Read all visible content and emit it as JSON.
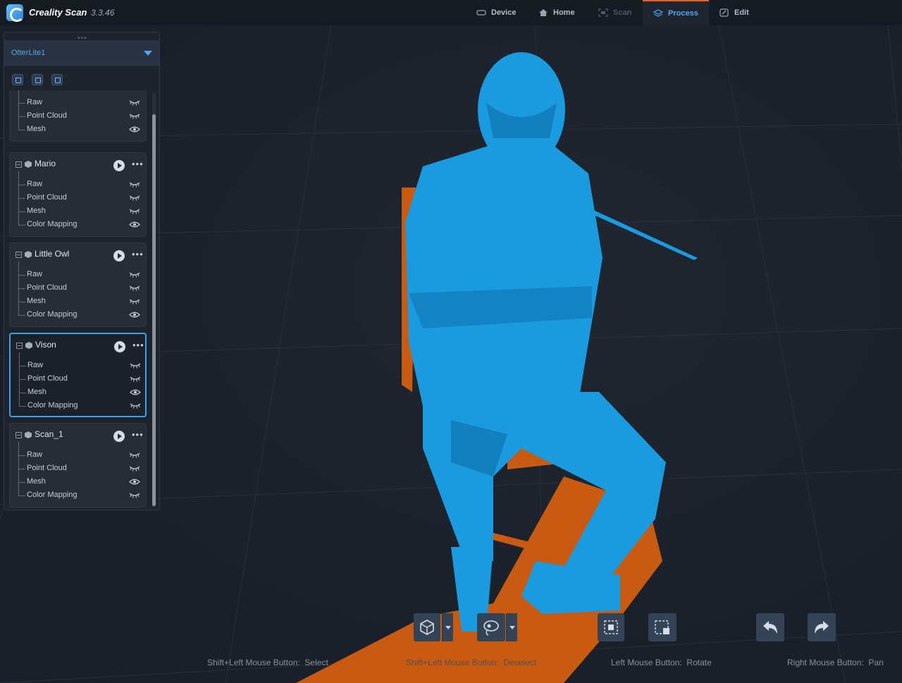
{
  "app": {
    "name": "Creality Scan",
    "version": "3.3.46"
  },
  "nav": {
    "tabs": [
      {
        "label": "Device",
        "icon": "device-icon",
        "state": "normal"
      },
      {
        "label": "Home",
        "icon": "home-icon",
        "state": "normal"
      },
      {
        "label": "Scan",
        "icon": "scan-icon",
        "state": "disabled"
      },
      {
        "label": "Process",
        "icon": "layers-icon",
        "state": "active"
      },
      {
        "label": "Edit",
        "icon": "edit-icon",
        "state": "normal"
      }
    ]
  },
  "sidebar": {
    "device": "OtterLite1",
    "tool_icons": [
      "add-project-icon",
      "import-folder-icon",
      "export-icon"
    ],
    "projects": [
      {
        "name": "",
        "partial": true,
        "layers": [
          {
            "label": "Raw",
            "visible": false
          },
          {
            "label": "Point Cloud",
            "visible": false
          },
          {
            "label": "Mesh",
            "visible": true
          }
        ]
      },
      {
        "name": "Mario",
        "layers": [
          {
            "label": "Raw",
            "visible": false
          },
          {
            "label": "Point Cloud",
            "visible": false
          },
          {
            "label": "Mesh",
            "visible": false
          },
          {
            "label": "Color Mapping",
            "visible": true
          }
        ]
      },
      {
        "name": "Little Owl",
        "layers": [
          {
            "label": "Raw",
            "visible": false
          },
          {
            "label": "Point Cloud",
            "visible": false
          },
          {
            "label": "Mesh",
            "visible": false
          },
          {
            "label": "Color Mapping",
            "visible": true
          }
        ]
      },
      {
        "name": "Vison",
        "selected": true,
        "layers": [
          {
            "label": "Raw",
            "visible": false
          },
          {
            "label": "Point Cloud",
            "visible": false
          },
          {
            "label": "Mesh",
            "visible": true
          },
          {
            "label": "Color Mapping",
            "visible": false
          }
        ]
      },
      {
        "name": "Scan_1",
        "layers": [
          {
            "label": "Raw",
            "visible": false
          },
          {
            "label": "Point Cloud",
            "visible": false
          },
          {
            "label": "Mesh",
            "visible": true
          },
          {
            "label": "Color Mapping",
            "visible": false
          }
        ]
      }
    ]
  },
  "viewport": {
    "model_color": "#1a9be0",
    "base_color": "#c95a12",
    "background": "#1a2029"
  },
  "toolbar": {
    "buttons": [
      "view-mode-icon",
      "lasso-select-icon",
      "invert-selection-icon",
      "delete-selection-icon",
      "undo-icon",
      "redo-icon"
    ]
  },
  "hints": [
    {
      "label": "Shift+Left Mouse Button:",
      "value": "Select"
    },
    {
      "label": "Shift+Left Mouse Button:",
      "value": "Deselect"
    },
    {
      "label": "Left Mouse Button:",
      "value": "Rotate"
    },
    {
      "label": "Right Mouse Button:",
      "value": "Pan"
    }
  ]
}
